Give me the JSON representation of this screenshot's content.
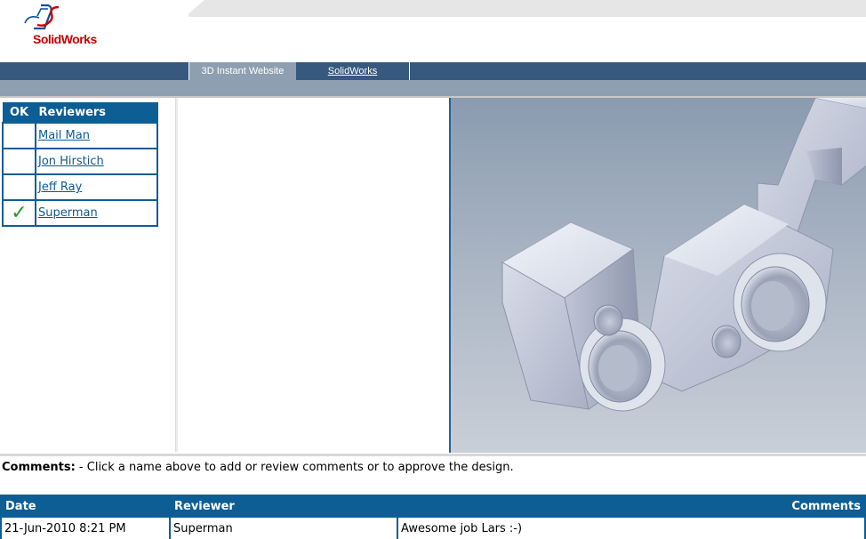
{
  "logo": {
    "brand": "SolidWorks",
    "mark": "DS"
  },
  "nav": {
    "tabs": [
      {
        "label": "3D Instant Website",
        "active": true
      },
      {
        "label": "SolidWorks",
        "active": false
      }
    ]
  },
  "reviewers": {
    "headers": {
      "ok": "OK",
      "name": "Reviewers"
    },
    "rows": [
      {
        "name": "Mail Man",
        "approved": false
      },
      {
        "name": "Jon Hirstich",
        "approved": false
      },
      {
        "name": "Jeff Ray",
        "approved": false
      },
      {
        "name": "Superman",
        "approved": true
      }
    ],
    "check_symbol": "✓"
  },
  "comments": {
    "label": "Comments:",
    "instruction": " - Click a name above to add or review comments or to approve the design.",
    "table": {
      "headers": {
        "date": "Date",
        "reviewer": "Reviewer",
        "comments": "Comments"
      },
      "rows": [
        {
          "date": "21-Jun-2010 8:21 PM",
          "reviewer": "Superman",
          "comment": "Awesome job Lars :-)"
        }
      ]
    }
  },
  "colors": {
    "nav_bar": "#37597d",
    "header_blue": "#0e5e96",
    "link": "#0b5b94",
    "check": "#1aa120",
    "brand_red": "#cc0000"
  },
  "viewer": {
    "model": "3d-part-model"
  }
}
